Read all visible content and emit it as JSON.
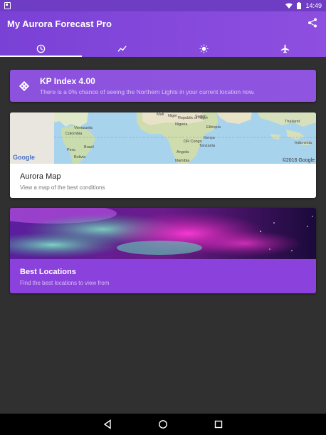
{
  "status_bar": {
    "time": "14:49"
  },
  "app_bar": {
    "title": "My Aurora Forecast Pro"
  },
  "tabs": [
    {
      "icon": "clock-icon",
      "active": true
    },
    {
      "icon": "trend-icon",
      "active": false
    },
    {
      "icon": "sun-icon",
      "active": false
    },
    {
      "icon": "airplane-icon",
      "active": false
    }
  ],
  "kp_card": {
    "title": "KP Index 4.00",
    "subtitle": "There is a 0% chance of seeing the Northern Lights in your current location now."
  },
  "map_card": {
    "title": "Aurora Map",
    "subtitle": "View a map of the best conditions",
    "google_logo": "Google",
    "copyright": "©2016 Google",
    "labels": {
      "mali": "Mali",
      "niger": "Niger",
      "republic_of_niger": "Republic of Niger",
      "sudan": "Sudan",
      "venezuela": "Venezuela",
      "colombia": "Colombia",
      "nigeria": "Nigeria",
      "ethiopia": "Ethiopia",
      "kenya": "Kenya",
      "dr_congo": "DR Congo",
      "tanzania": "Tanzania",
      "peru": "Peru",
      "brazil": "Brazil",
      "bolivia": "Bolivia",
      "angola": "Angola",
      "namibia": "Namibia",
      "indonesia": "Indonesia",
      "thailand": "Thailand"
    }
  },
  "locations_card": {
    "title": "Best Locations",
    "subtitle": "Find the best locations to view from"
  },
  "colors": {
    "status_bar": "#6f3cc4",
    "app_bar": "#8a4ddf",
    "card_purple": "#8b42dc",
    "background": "#303030"
  }
}
